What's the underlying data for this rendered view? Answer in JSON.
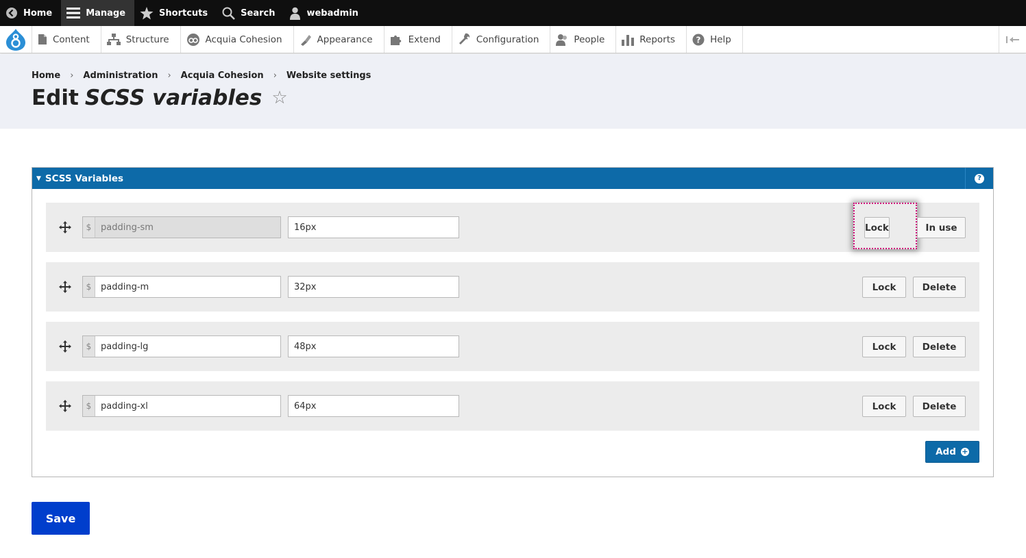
{
  "toolbar": {
    "home": "Home",
    "manage": "Manage",
    "shortcuts": "Shortcuts",
    "search": "Search",
    "user": "webadmin"
  },
  "tray": {
    "items": [
      "Content",
      "Structure",
      "Acquia Cohesion",
      "Appearance",
      "Extend",
      "Configuration",
      "People",
      "Reports",
      "Help"
    ]
  },
  "breadcrumb": [
    "Home",
    "Administration",
    "Acquia Cohesion",
    "Website settings"
  ],
  "page": {
    "title_prefix": "Edit",
    "title_italic": "SCSS variables",
    "star": "☆"
  },
  "fieldset": {
    "legend": "SCSS Variables",
    "help": "?"
  },
  "rows": [
    {
      "prefix": "$",
      "name": "padding-sm",
      "value": "16px",
      "lock": "Lock",
      "action": "In use"
    },
    {
      "prefix": "$",
      "name": "padding-m",
      "value": "32px",
      "lock": "Lock",
      "action": "Delete"
    },
    {
      "prefix": "$",
      "name": "padding-lg",
      "value": "48px",
      "lock": "Lock",
      "action": "Delete"
    },
    {
      "prefix": "$",
      "name": "padding-xl",
      "value": "64px",
      "lock": "Lock",
      "action": "Delete"
    }
  ],
  "buttons": {
    "add": "Add",
    "save": "Save"
  },
  "colors": {
    "toolbar_bg": "#0f0f0f",
    "accent_blue": "#0d6aa8",
    "save_blue": "#003ecc",
    "focus_outline": "#d0087a"
  }
}
